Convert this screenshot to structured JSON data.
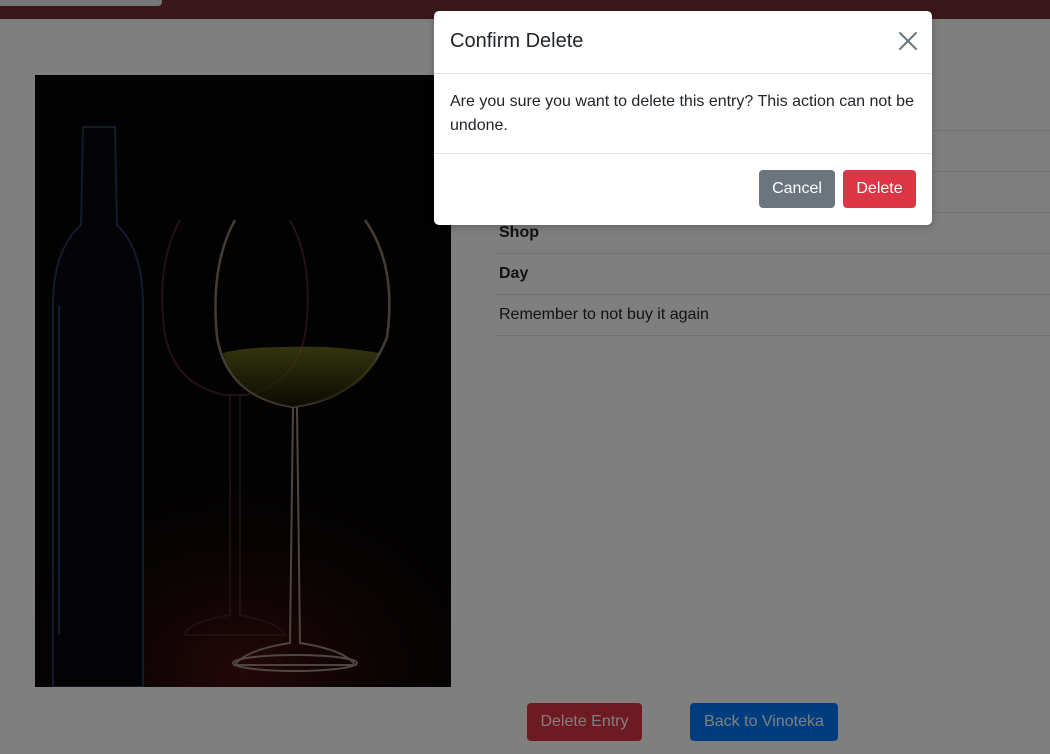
{
  "details": {
    "rows": [
      {
        "label": "",
        "bold": false
      },
      {
        "label": "",
        "bold": false
      },
      {
        "label": "",
        "bold": false
      },
      {
        "label": "Shop",
        "bold": true
      },
      {
        "label": "Day",
        "bold": true
      },
      {
        "label": "Remember to not buy it again",
        "bold": false
      }
    ]
  },
  "actions": {
    "delete_entry_label": "Delete Entry",
    "back_label": "Back to Vinoteka"
  },
  "modal": {
    "title": "Confirm Delete",
    "message": "Are you sure you want to delete this entry? This action can not be undone.",
    "cancel_label": "Cancel",
    "delete_label": "Delete",
    "close_icon": "close-icon"
  },
  "colors": {
    "navbar": "#722f37",
    "danger": "#dc3545",
    "primary": "#007bff",
    "secondary": "#6c757d",
    "backdrop": "rgba(0,0,0,0.5)"
  }
}
